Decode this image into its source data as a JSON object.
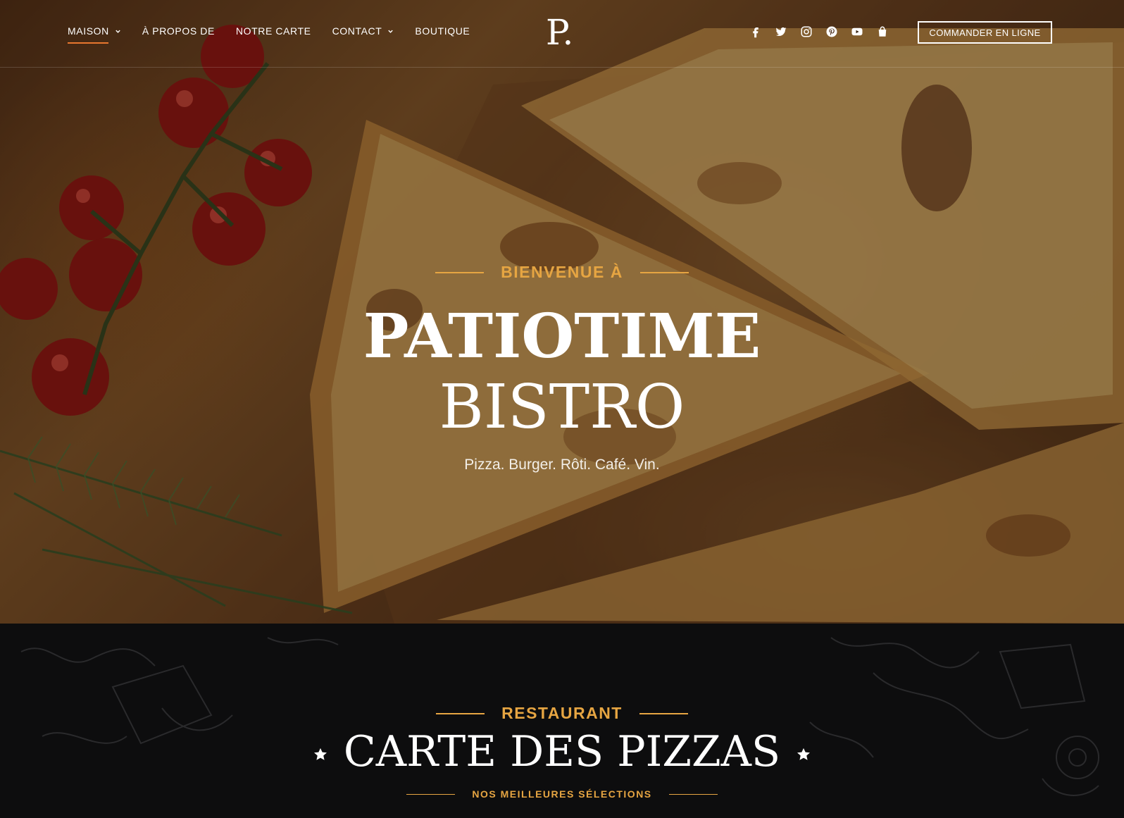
{
  "header": {
    "nav": [
      {
        "label": "MAISON",
        "dropdown": true,
        "active": true
      },
      {
        "label": "À PROPOS DE",
        "dropdown": false,
        "active": false
      },
      {
        "label": "NOTRE CARTE",
        "dropdown": false,
        "active": false
      },
      {
        "label": "CONTACT",
        "dropdown": true,
        "active": false
      },
      {
        "label": "BOUTIQUE",
        "dropdown": false,
        "active": false
      }
    ],
    "logo": "P.",
    "socials": [
      "facebook-icon",
      "twitter-icon",
      "instagram-icon",
      "pinterest-icon",
      "youtube-icon",
      "shopping-bag-icon"
    ],
    "order_button": "COMMANDER EN LIGNE"
  },
  "hero": {
    "eyebrow": "BIENVENUE À",
    "title_line1": "PATIOTIME",
    "title_line2": "BISTRO",
    "subtitle": "Pizza. Burger. Rôti. Café. Vin."
  },
  "menu_section": {
    "eyebrow": "RESTAURANT",
    "title": "CARTE DES PIZZAS",
    "subtitle": "NOS MEILLEURES SÉLECTIONS"
  },
  "colors": {
    "accent": "#e6a542",
    "nav_active_underline": "#e8772e",
    "section_background": "#0d0d0e"
  }
}
